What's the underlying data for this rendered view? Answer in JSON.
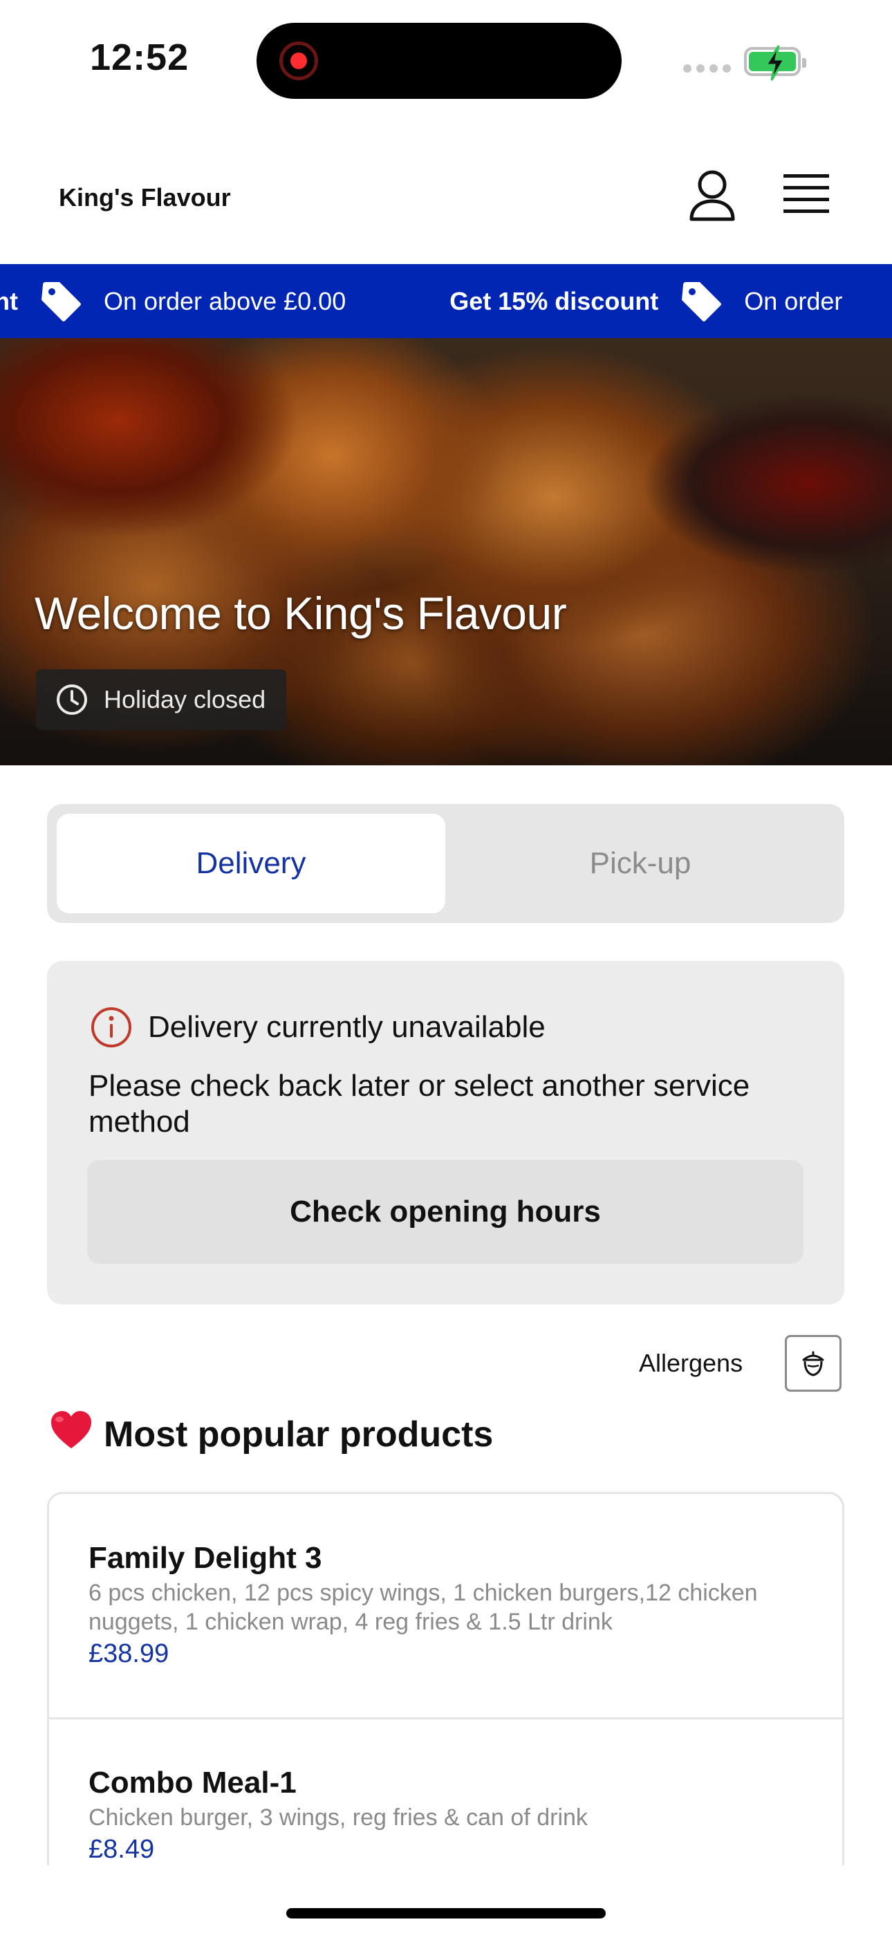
{
  "status_bar": {
    "time": "12:52"
  },
  "header": {
    "brand": "King's Flavour"
  },
  "promo": {
    "items": [
      {
        "strong": "unt",
        "text": "On order above £0.00"
      },
      {
        "strong": "Get 15% discount",
        "text": "On order"
      }
    ]
  },
  "hero": {
    "title": "Welcome to King's Flavour",
    "status": "Holiday closed"
  },
  "service": {
    "options": [
      "Delivery",
      "Pick-up"
    ],
    "selected": "Delivery"
  },
  "notice": {
    "title": "Delivery currently unavailable",
    "message": "Please check back later or select another service method",
    "button": "Check opening hours"
  },
  "allergens": {
    "label": "Allergens"
  },
  "popular": {
    "title": "Most popular products",
    "emoji": "❤️",
    "products": [
      {
        "name": "Family Delight 3",
        "description": "6 pcs chicken, 12 pcs spicy wings, 1 chicken burgers,12 chicken nuggets, 1 chicken wrap, 4 reg fries & 1.5 Ltr drink",
        "price": "£38.99"
      },
      {
        "name": "Combo Meal-1",
        "description": "Chicken burger, 3 wings, reg fries & can of drink",
        "price": "£8.49"
      }
    ]
  },
  "colors": {
    "accent": "#0026b3",
    "accent_text": "#1433a3",
    "card_bg": "#ececec"
  }
}
